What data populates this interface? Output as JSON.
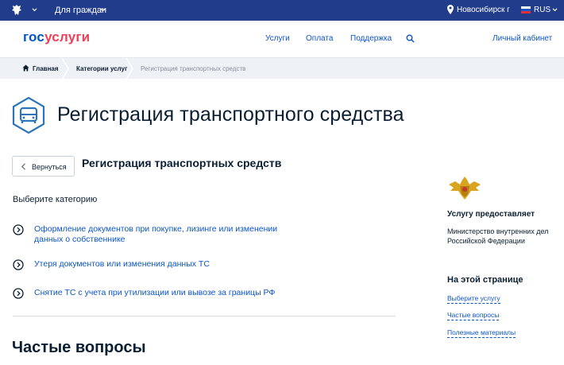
{
  "topbar": {
    "for_citizens": "Для граждан",
    "location": "Новосибирск г",
    "language": "RUS"
  },
  "header": {
    "logo_part1": "гос",
    "logo_part2": "услуги",
    "nav": [
      "Услуги",
      "Оплата",
      "Поддержка"
    ],
    "cabinet": "Личный кабинет"
  },
  "breadcrumbs": {
    "home": "Главная",
    "categories": "Категории услуг",
    "current": "Регистрация транспортных средств"
  },
  "page": {
    "title": "Регистрация транспортного средства",
    "back_label": "Вернуться",
    "subtitle": "Регистрация транспортных средств",
    "choose_category": "Выберите категорию",
    "categories": [
      "Оформление документов при покупке, лизинге или изменении данных о собственнике",
      "Утеря документов или изменения данных ТС",
      "Снятие ТС с учета при утилизации или вывозе за границы РФ"
    ],
    "faq_heading": "Частые вопросы"
  },
  "sidebar": {
    "provider_heading": "Услугу предоставляет",
    "provider_name": "Министерство внутренних дел Российской Федерации",
    "onpage_heading": "На этой странице",
    "onpage_links": [
      "Выберите услугу",
      "Частые вопросы",
      "Полезные материалы"
    ]
  },
  "colors": {
    "topbar": "#213c8a",
    "link": "#0b55c8",
    "brand_red": "#ee3f58",
    "icon_blue": "#2d74b8"
  }
}
